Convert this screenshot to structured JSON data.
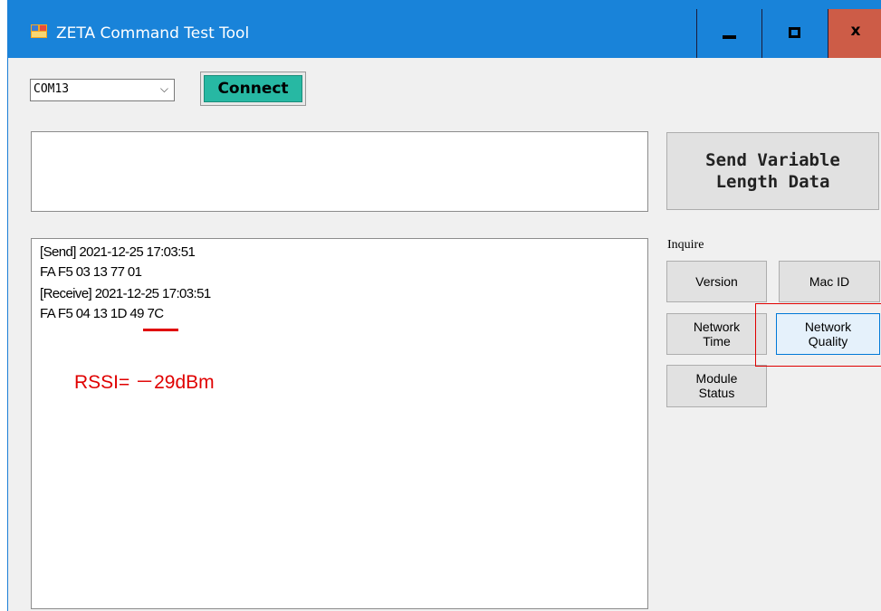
{
  "window": {
    "title": "ZETA Command Test Tool",
    "controls": {
      "minimize": "minimize-icon",
      "maximize": "maximize-icon",
      "close": "x"
    }
  },
  "connection": {
    "port_value": "COM13",
    "connect_label": "Connect",
    "connect_color": "#27b8a3"
  },
  "send": {
    "input_value": "",
    "variable_button_line1": "Send Variable",
    "variable_button_line2": "Length Data"
  },
  "log": {
    "lines": [
      "[Send] 2021-12-25 17:03:51",
      "FA F5 03 13 77 01",
      "[Receive] 2021-12-25 17:03:51",
      "FA F5 04 13 1D 49 7C"
    ],
    "annotation": "RSSI= －29dBm",
    "annotation_color": "#e00000"
  },
  "inquire": {
    "label": "Inquire",
    "buttons": {
      "version": "Version",
      "mac_id": "Mac ID",
      "network_time_1": "Network",
      "network_time_2": "Time",
      "network_quality_1": "Network",
      "network_quality_2": "Quality",
      "module_status_1": "Module",
      "module_status_2": "Status"
    }
  }
}
